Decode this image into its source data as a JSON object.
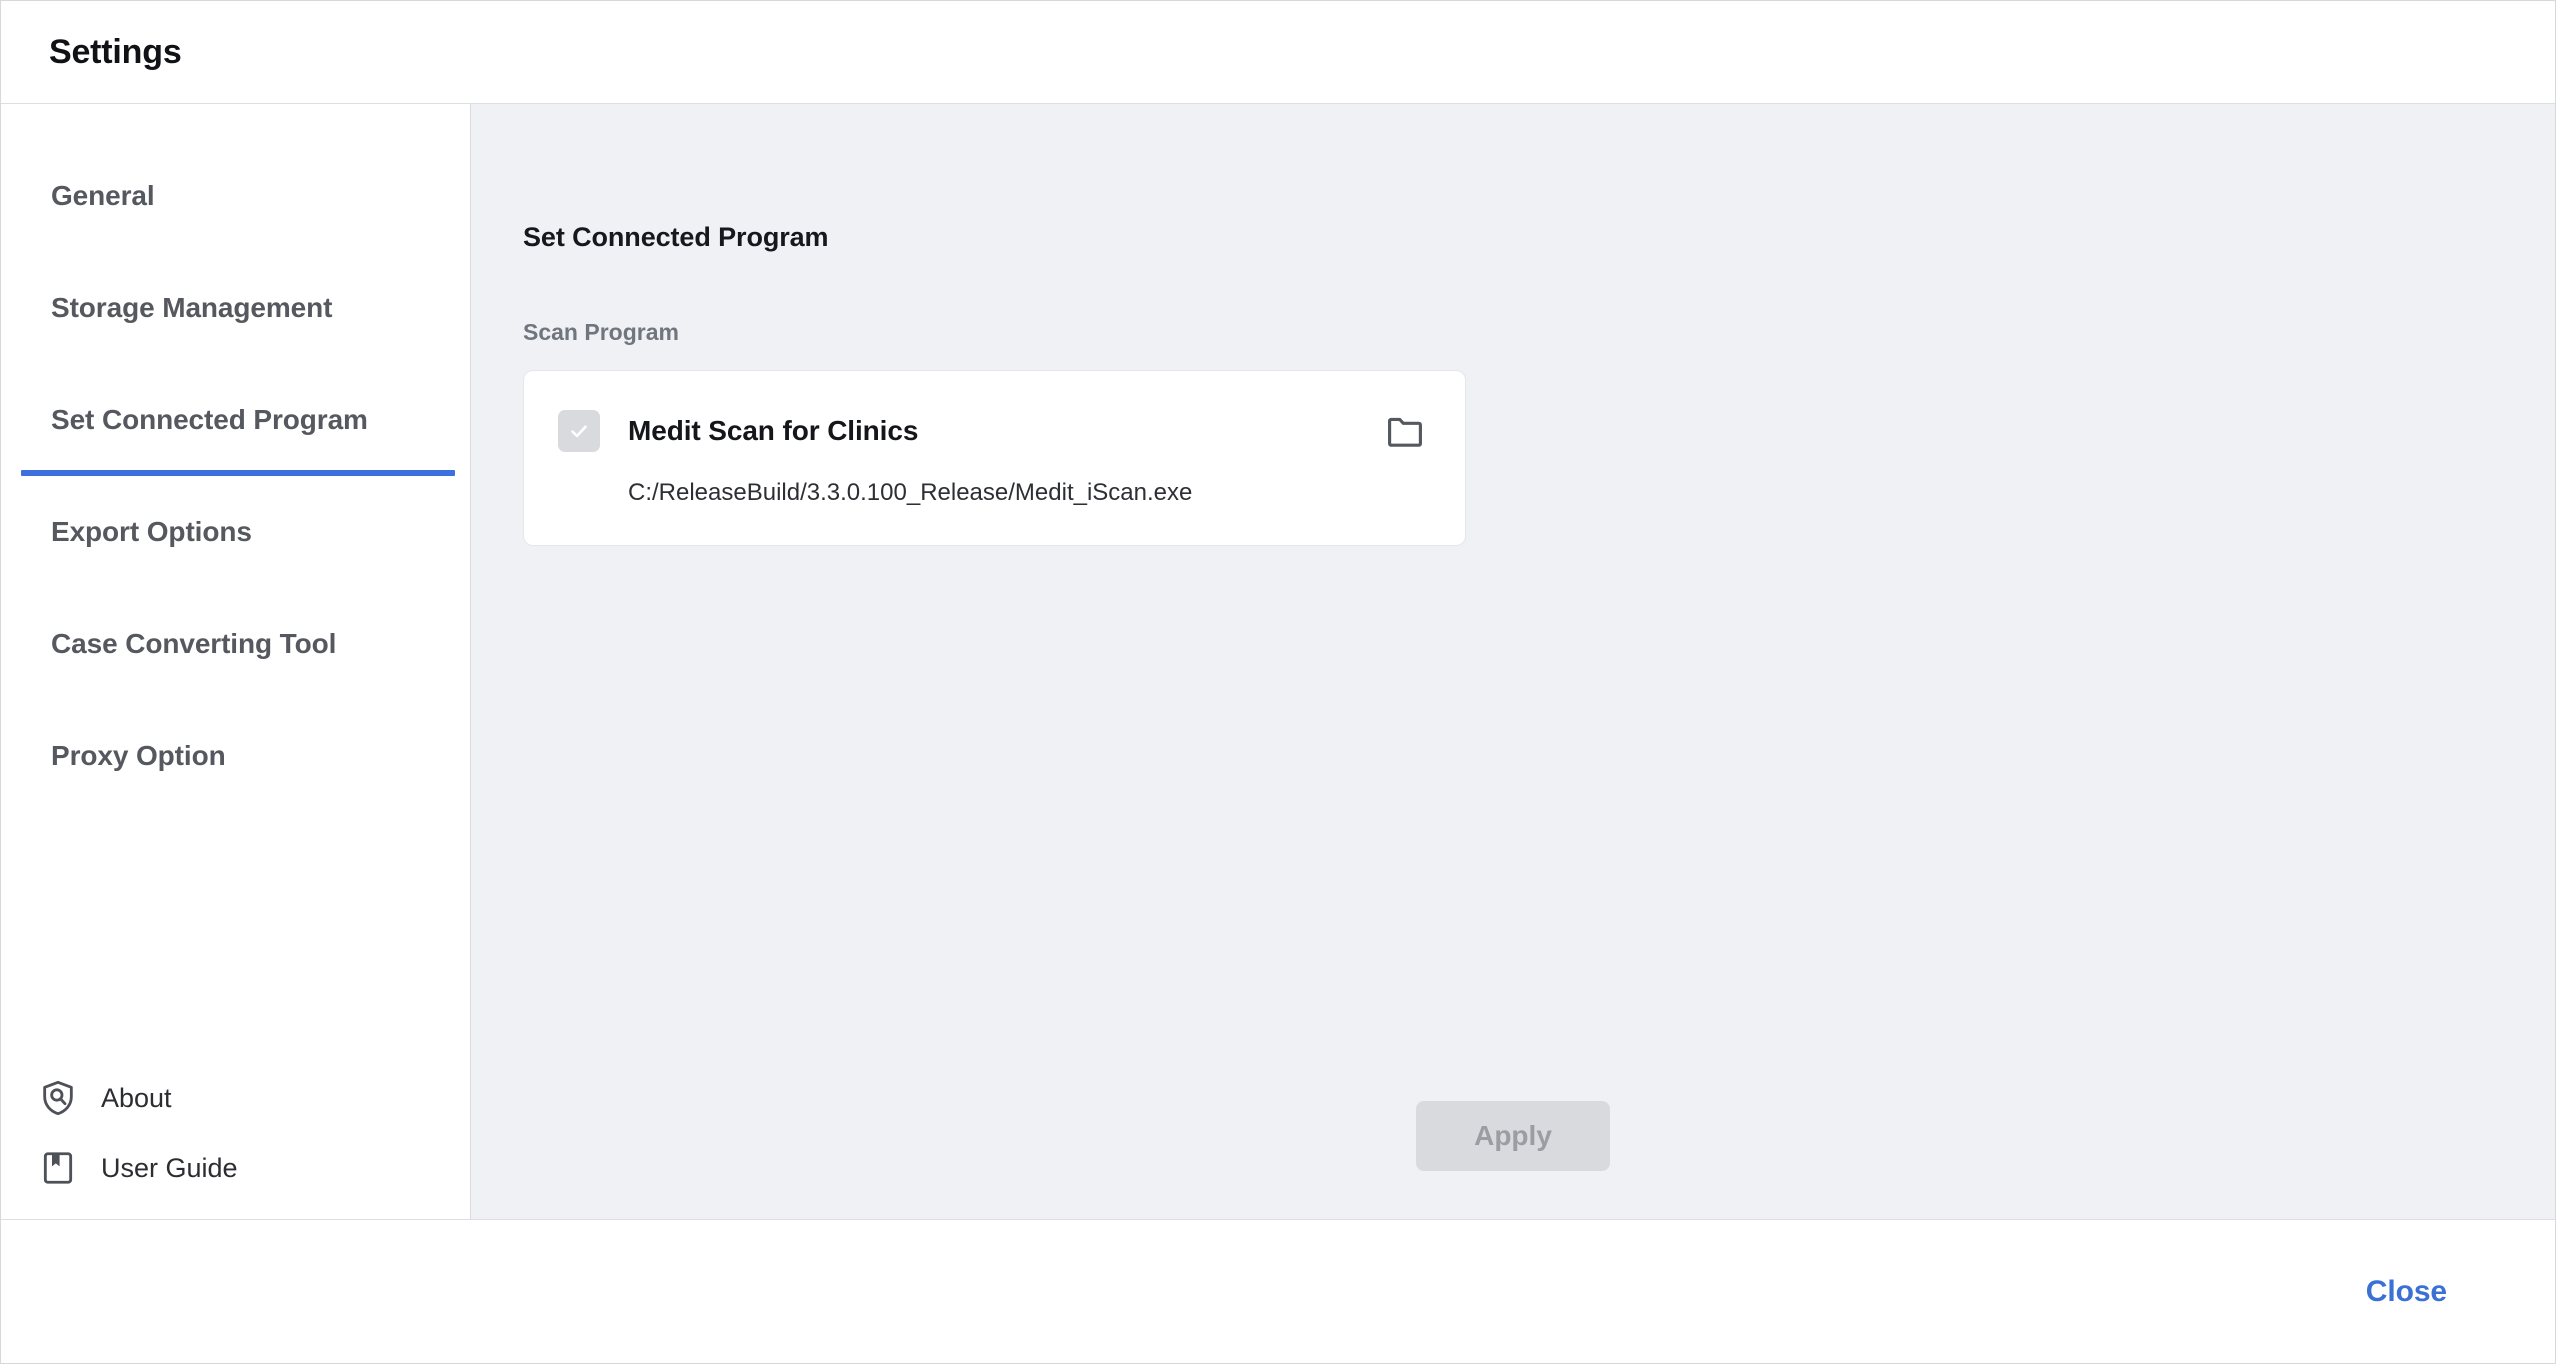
{
  "window": {
    "title": "Settings"
  },
  "sidebar": {
    "items": [
      {
        "label": "General",
        "active": false
      },
      {
        "label": "Storage Management",
        "active": false
      },
      {
        "label": "Set Connected Program",
        "active": true
      },
      {
        "label": "Export Options",
        "active": false
      },
      {
        "label": "Case Converting Tool",
        "active": false
      },
      {
        "label": "Proxy Option",
        "active": false
      }
    ],
    "footer": [
      {
        "label": "About",
        "icon": "shield-info-icon"
      },
      {
        "label": "User Guide",
        "icon": "book-bookmark-icon"
      }
    ]
  },
  "main": {
    "section_title": "Set Connected Program",
    "field_label": "Scan Program",
    "program": {
      "name": "Medit Scan for Clinics",
      "path": "C:/ReleaseBuild/3.3.0.100_Release/Medit_iScan.exe",
      "checked": true,
      "browse_icon": "folder-icon"
    },
    "apply_label": "Apply"
  },
  "footer": {
    "close_label": "Close"
  },
  "colors": {
    "accent_blue": "#3b70de",
    "link_blue": "#3b70d4",
    "panel_bg": "#eff1f5",
    "sidebar_text": "#55585e",
    "disabled_bg": "#d8dade",
    "disabled_text": "#9b9da3"
  }
}
